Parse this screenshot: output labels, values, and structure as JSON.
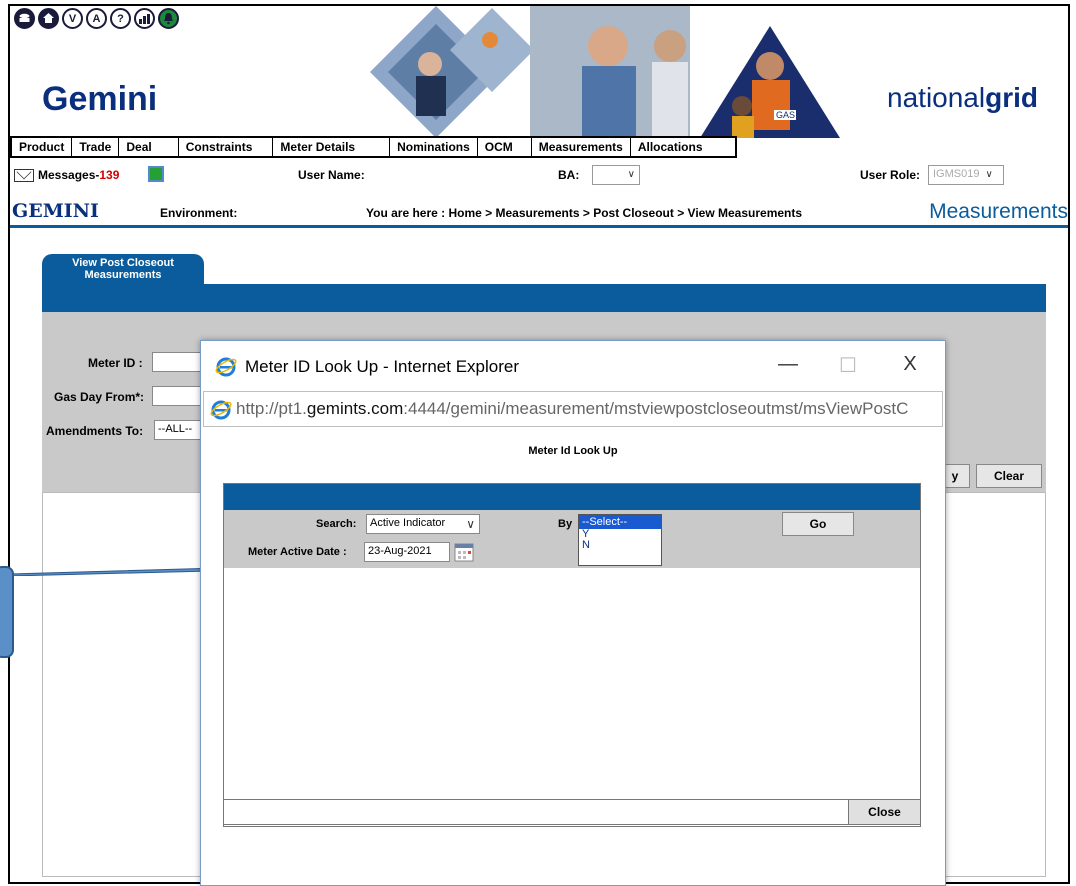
{
  "header": {
    "icon_letters": [
      "",
      "",
      "V",
      "A",
      "?",
      "",
      ""
    ],
    "icon_names": [
      "disk-icon",
      "home-icon",
      "v-icon",
      "a-icon",
      "help-icon",
      "chart-icon",
      "bell-icon"
    ],
    "app_logo": "Gemini",
    "brand_prefix": "national",
    "brand_suffix": "grid"
  },
  "menu": [
    "Product",
    "Trade",
    "Deal",
    "Constraints",
    "Meter Details",
    "Nominations",
    "OCM",
    "Measurements",
    "Allocations"
  ],
  "row2": {
    "messages_label": "Messages-",
    "messages_count": "139",
    "user_name_label": "User Name:",
    "ba_label": "BA:",
    "user_role_label": "User Role:",
    "user_role_value": "IGMS019"
  },
  "row3": {
    "logo": "GEMINI",
    "environment_label": "Environment:",
    "breadcrumb": "You are here : Home > Measurements > Post Closeout > View Measurements",
    "section": "Measurements"
  },
  "main": {
    "tab_label": "View Post Closeout Measurements",
    "meter_id_label": "Meter ID :",
    "gas_day_from_label": "Gas Day From*:",
    "amendments_to_label": "Amendments To:",
    "amendments_to_value": "--ALL--",
    "view_button_partial": "y",
    "clear_button": "Clear"
  },
  "popup": {
    "title": "Meter ID Look Up - Internet Explorer",
    "minimize": "—",
    "maximize": "☐",
    "close": "X",
    "url_prefix": "http://pt1.",
    "url_domain": "gemints.com",
    "url_suffix": ":4444/gemini/measurement/mstviewpostcloseoutmst/msViewPostC",
    "heading": "Meter Id Look Up",
    "search_label": "Search:",
    "search_value": "Active Indicator",
    "by_label": "By",
    "by_options": [
      "--Select--",
      "Y",
      "N"
    ],
    "by_selected": "--Select--",
    "go_button": "Go",
    "meter_active_date_label": "Meter Active Date :",
    "meter_active_date_value": "23-Aug-2021",
    "close_button": "Close"
  },
  "colors": {
    "brand_blue": "#0a2f7d",
    "bar_blue": "#0a5c9c",
    "panel_gray": "#c9c9c9",
    "alert_red": "#d40000"
  }
}
